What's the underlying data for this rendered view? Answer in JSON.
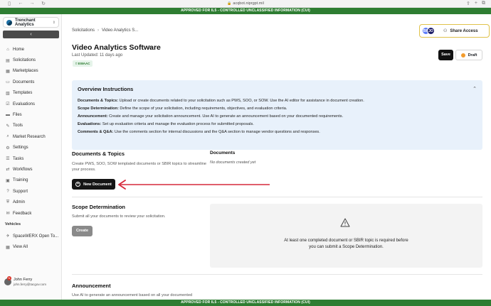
{
  "browser": {
    "url": "acqbot.niprgpt.mil",
    "nav": {
      "sidebar_icon": "sidebar-icon",
      "back_icon": "arrow-left-icon",
      "forward_icon": "arrow-right-icon",
      "reload_icon": "reload-icon"
    }
  },
  "banner": {
    "top": "APPROVED FOR IL5 - CONTROLLED UNCLASSIFIED INFORMATION (CUI)",
    "bottom": "APPROVED FOR IL5 - CONTROLLED UNCLASSIFIED INFORMATION (CUI)",
    "color": "#2e7d32"
  },
  "sidebar": {
    "org_name": "Trenchant Analytics",
    "collapse_glyph": "‹",
    "items": [
      {
        "label": "Home",
        "icon": "home-icon",
        "glyph": "⌂"
      },
      {
        "label": "Solicitations",
        "icon": "document-icon",
        "glyph": "▤"
      },
      {
        "label": "Marketplaces",
        "icon": "store-icon",
        "glyph": "▦"
      },
      {
        "label": "Documents",
        "icon": "file-icon",
        "glyph": "▭"
      },
      {
        "label": "Templates",
        "icon": "template-icon",
        "glyph": "▧"
      },
      {
        "label": "Evaluations",
        "icon": "evaluation-icon",
        "glyph": "☑"
      },
      {
        "label": "Files",
        "icon": "folder-icon",
        "glyph": "▬"
      },
      {
        "label": "Tools",
        "icon": "tools-icon",
        "glyph": "✎"
      },
      {
        "label": "Market Research",
        "icon": "search-icon",
        "glyph": "⌕"
      },
      {
        "label": "Settings",
        "icon": "gear-icon",
        "glyph": "⚙"
      },
      {
        "label": "Tasks",
        "icon": "tasks-icon",
        "glyph": "☰"
      },
      {
        "label": "Workflows",
        "icon": "workflow-icon",
        "glyph": "⇄"
      },
      {
        "label": "Training",
        "icon": "training-icon",
        "glyph": "▣"
      },
      {
        "label": "Support",
        "icon": "support-icon",
        "glyph": "?"
      },
      {
        "label": "Admin",
        "icon": "shield-icon",
        "glyph": "⛨"
      },
      {
        "label": "Feedback",
        "icon": "feedback-icon",
        "glyph": "✉"
      }
    ],
    "vehicles_label": "Vehicles",
    "vehicles": [
      {
        "label": "SpaceWERX Open To...",
        "icon": "rocket-icon",
        "glyph": "✈"
      },
      {
        "label": "View All",
        "icon": "grid-icon",
        "glyph": "▦"
      }
    ],
    "user": {
      "name": "John Ferry",
      "email": "john.ferry@tacgov.com",
      "badge": "N"
    }
  },
  "header": {
    "breadcrumb": [
      "Solicitations",
      "Video Analytics S..."
    ],
    "breadcrumb_sep": "›",
    "avatars": [
      "BR",
      "JO"
    ],
    "share_label": "Share Access"
  },
  "page": {
    "title": "Video Analytics Software",
    "updated": "Last Updated: 11 days ago",
    "tag": "EWAAC",
    "save_label": "Save",
    "draft_label": "Draft"
  },
  "overview": {
    "title": "Overview Instructions",
    "toggle": "⌃",
    "lines": [
      {
        "label": "Documents & Topics:",
        "text": " Upload or create documents related to your solicitation such as PWS, SOO, or SOW. Use the AI editor for assistance in document creation."
      },
      {
        "label": "Scope Determination:",
        "text": " Define the scope of your solicitation, including requirements, objectives, and evaluation criteria."
      },
      {
        "label": "Announcement:",
        "text": " Create and manage your solicitation announcement. Use AI to generate an announcement based on your documented requirements."
      },
      {
        "label": "Evaluations:",
        "text": " Set up evaluation criteria and manage the evaluation process for submitted proposals."
      },
      {
        "label": "Comments & Q&A:",
        "text": " Use the comments section for internal discussions and the Q&A section to manage vendor questions and responses."
      }
    ]
  },
  "documents_topics": {
    "title": "Documents & Topics",
    "description": "Create PWS, SOO, SOW templated documents or SBIR topics to streamline your process.",
    "new_doc_label": "New Document",
    "docs_title": "Documents",
    "docs_empty": "No documents created yet"
  },
  "scope": {
    "title": "Scope Determination",
    "description": "Submit all your documents to review your solicitation.",
    "create_label": "Create",
    "message": "At least one completed document or SBIR topic is required before you can submit a Scope Determination."
  },
  "announcement": {
    "title": "Announcement",
    "description": "Use AI to generate an announcement based on all your documented"
  }
}
